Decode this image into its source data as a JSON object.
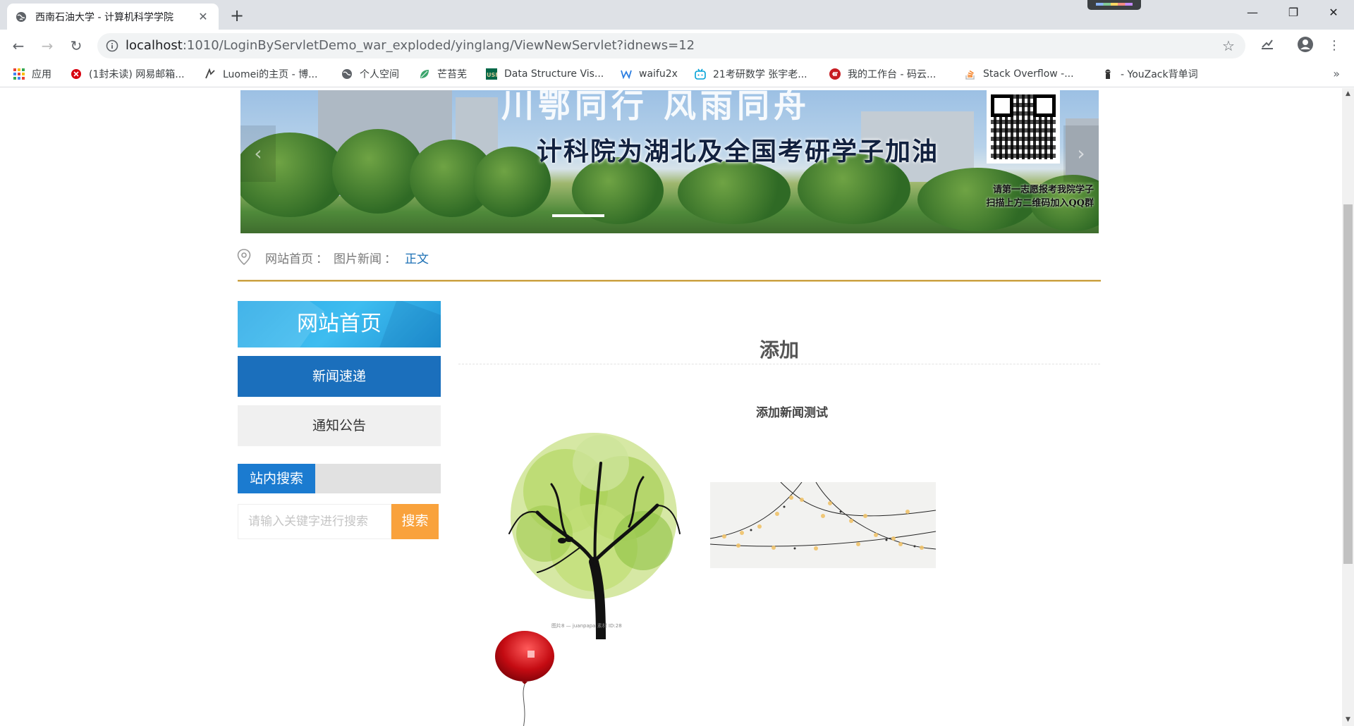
{
  "browser": {
    "tab_title": "西南石油大学 - 计算机科学学院",
    "tab_close": "✕",
    "new_tab": "+",
    "window_controls": [
      "—",
      "❐",
      "✕"
    ],
    "url_host": "localhost",
    "url_rest": ":1010/LoginByServletDemo_war_exploded/yinglang/ViewNewServlet?idnews=12",
    "icons": [
      "back-icon",
      "forward-icon",
      "reload-icon",
      "info-icon",
      "star-icon",
      "extension-icon",
      "account-icon",
      "menu-icon"
    ],
    "bookmarks": [
      {
        "label": "应用",
        "icon": "apps-grid-icon"
      },
      {
        "label": "(1封未读) 网易邮箱...",
        "icon": "netease-mail-icon"
      },
      {
        "label": "Luomei的主页 - 博...",
        "icon": "blog-icon"
      },
      {
        "label": "个人空间",
        "icon": "globe-icon"
      },
      {
        "label": "芒苔芜",
        "icon": "leaf-icon"
      },
      {
        "label": "Data Structure Vis...",
        "icon": "usf-icon"
      },
      {
        "label": "waifu2x",
        "icon": "waifu2x-icon"
      },
      {
        "label": "21考研数学 张宇老...",
        "icon": "bilibili-icon"
      },
      {
        "label": "我的工作台 - 码云...",
        "icon": "gitee-icon"
      },
      {
        "label": "Stack Overflow -...",
        "icon": "stackoverflow-icon"
      },
      {
        "label": "- YouZack背单词",
        "icon": "youzack-icon"
      }
    ],
    "bookmarks_more": "»"
  },
  "banner": {
    "slogan_top": "川鄂同行 风雨同舟",
    "slogan": "计科院为湖北及全国考研学子加油",
    "qr_note_line1": "请第一志愿报考我院学子",
    "qr_note_line2": "扫描上方二维码加入QQ群",
    "prev": "‹",
    "next": "›"
  },
  "breadcrumb": {
    "home": "网站首页",
    "section": "图片新闻",
    "sep": "：",
    "current": "正文"
  },
  "sidebar": {
    "home": "网站首页",
    "items": [
      "新闻速递",
      "通知公告"
    ],
    "search_title": "站内搜索",
    "search_placeholder": "请输入关键字进行搜索",
    "search_button": "搜索"
  },
  "article": {
    "title": "添加",
    "subtitle": "添加新闻测试",
    "tree_caption": "图片8 — juanpapa 素材 ID:28"
  },
  "colors": {
    "gold_line": "#caa043",
    "nav_active": "#1b6fbc",
    "search_button": "#f9a23c",
    "link": "#1a6fb4"
  }
}
